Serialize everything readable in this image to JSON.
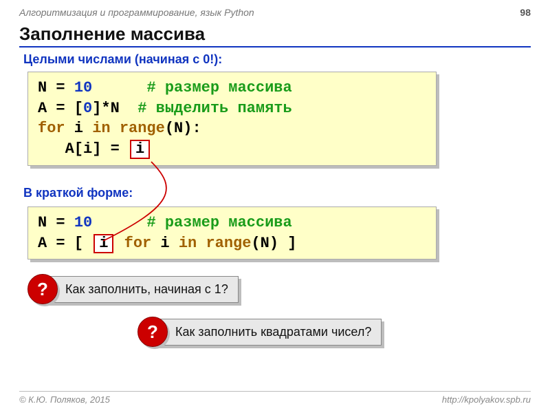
{
  "header": {
    "course": "Алгоритмизация и программирование, язык Python",
    "page": "98"
  },
  "title": "Заполнение массива",
  "sub1": "Целыми числами (начиная с 0!):",
  "sub2": "В краткой форме:",
  "code1": {
    "l1_a": "N = ",
    "l1_b": "10",
    "l1_c": "      ",
    "l1_d": "# размер массива",
    "l2_a": "A = [",
    "l2_b": "0",
    "l2_c": "]*N  ",
    "l2_d": "# выделить память",
    "l3_a": "for",
    "l3_b": " i ",
    "l3_c": "in",
    "l3_d": " ",
    "l3_e": "range",
    "l3_f": "(N):",
    "l4_a": "   A[i] = ",
    "l4_chip": "i"
  },
  "code2": {
    "l1_a": "N = ",
    "l1_b": "10",
    "l1_c": "      ",
    "l1_d": "# размер массива",
    "l2_a": "A = [ ",
    "l2_chip": "i",
    "l2_b": " ",
    "l2_c": "for",
    "l2_d": " i ",
    "l2_e": "in",
    "l2_f": " ",
    "l2_g": "range",
    "l2_h": "(N) ]"
  },
  "q1": {
    "mark": "?",
    "text": " Как заполнить, начиная с 1?"
  },
  "q2": {
    "mark": "?",
    "text": " Как заполнить квадратами чисел?"
  },
  "footer": {
    "author": "© К.Ю. Поляков, 2015",
    "url": "http://kpolyakov.spb.ru"
  }
}
